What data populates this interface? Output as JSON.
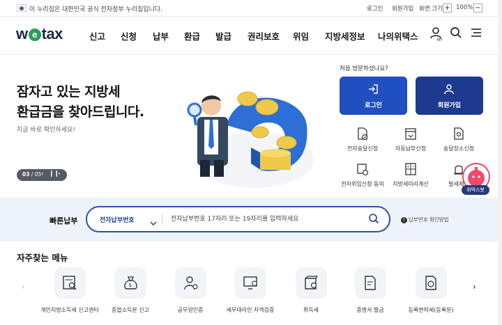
{
  "gov_bar": {
    "notice": "이 누리집은 대한민국 공식 전자정부 누리집입니다.",
    "login": "로그인",
    "signup": "회원가입",
    "screen_size": "화면 크기",
    "zoom_in": "+",
    "zoom_level": "100%",
    "zoom_out": "−"
  },
  "header": {
    "logo_pre": "w",
    "logo_e": "e",
    "logo_post": "tax",
    "nav": [
      "신고",
      "신청",
      "납부",
      "환급",
      "발급",
      "권리보호",
      "위임",
      "지방세정보",
      "나의위택스"
    ],
    "my_label": "MY"
  },
  "hero": {
    "title_line1": "잠자고 있는 지방세",
    "title_line2": "환급금을 찾아드립니다.",
    "subtitle": "지금 바로 확인하세요!",
    "pager_current": "03",
    "pager_total": "/ 05"
  },
  "panel": {
    "question": "처음 방문하셨나요?",
    "login_button": "로그인",
    "signup_button": "회원가입",
    "services": [
      "전자송달신청",
      "자동납부신청",
      "송달장소신청",
      "전자위임신청·동의",
      "지방세미리계산",
      "탈세제보"
    ]
  },
  "quick_pay": {
    "label": "빠른납부",
    "select_value": "전자납부번호",
    "input_placeholder": "전자납부번호 17자리 또는 19자리를 입력하세요",
    "help": "납부번호 확인방법"
  },
  "faq": {
    "title": "자주찾는 메뉴",
    "items": [
      "개인지방소득세 신고센터",
      "종합소득분 신고",
      "공무원인증",
      "세무대리인 자격검증",
      "취득세",
      "증명서 발급",
      "등록면허세(등록분)"
    ]
  },
  "floating": {
    "bot_label": "위텍스봇"
  },
  "colors": {
    "primary": "#1f4fc0",
    "navy": "#1d3a8f",
    "quick_bg": "#edf3f9"
  }
}
